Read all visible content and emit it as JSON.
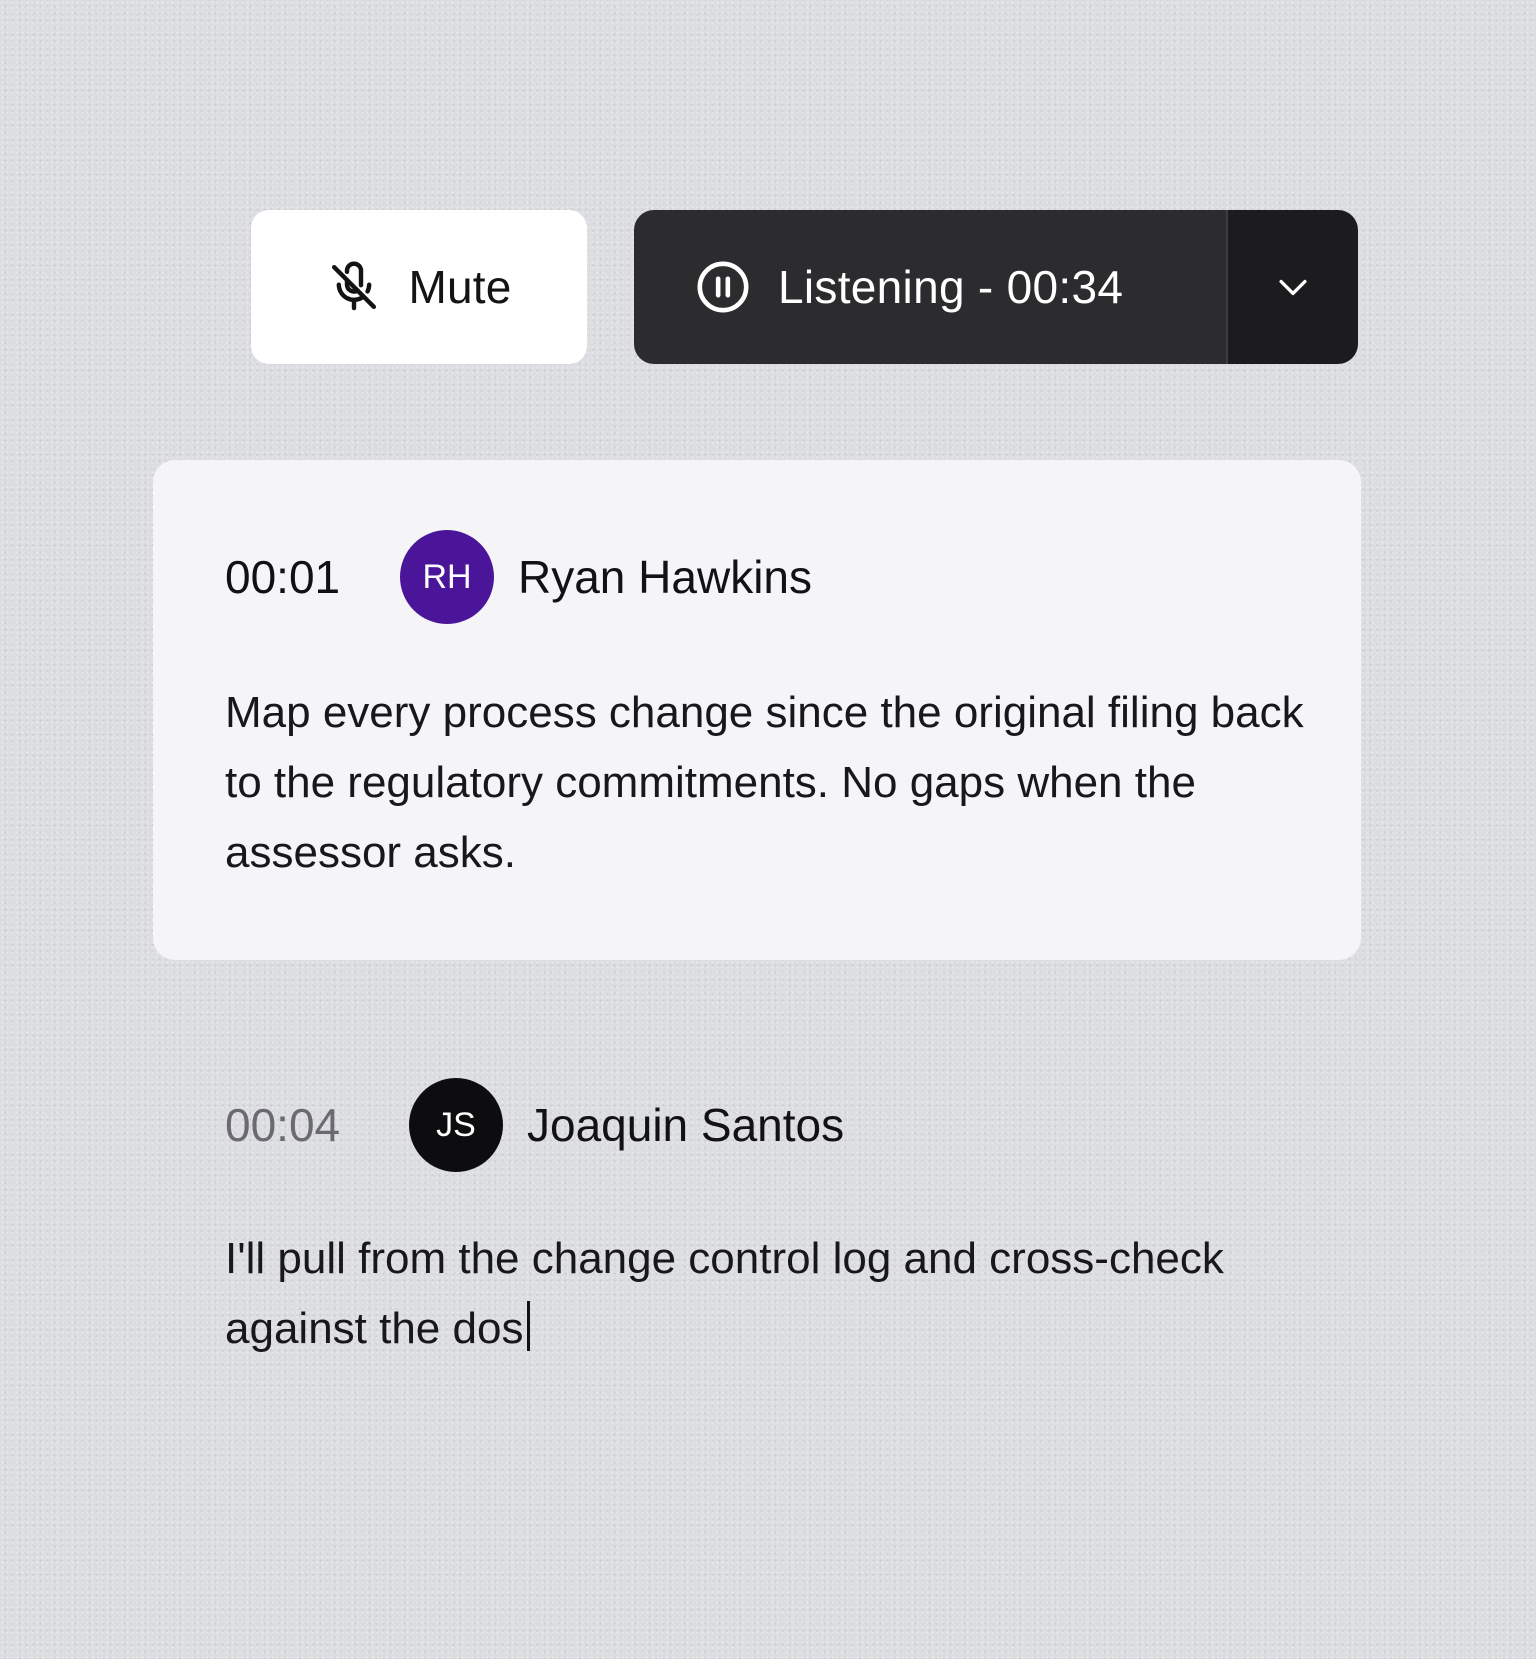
{
  "controls": {
    "mute_label": "Mute",
    "mute_icon": "mic-off-icon",
    "listening_label": "Listening - 00:34",
    "listening_icon": "pause-circle-icon",
    "dropdown_icon": "chevron-down-icon"
  },
  "transcript": [
    {
      "time": "00:01",
      "initials": "RH",
      "avatar_color": "#4a1599",
      "speaker": "Ryan Hawkins",
      "text": "Map every process change since the original filing back to the regulatory commitments. No gaps when the assessor asks."
    },
    {
      "time": "00:04",
      "initials": "JS",
      "avatar_color": "#0d0d0f",
      "speaker": "Joaquin Santos",
      "text": "I'll pull from the change control log and cross-check against the dos"
    }
  ]
}
